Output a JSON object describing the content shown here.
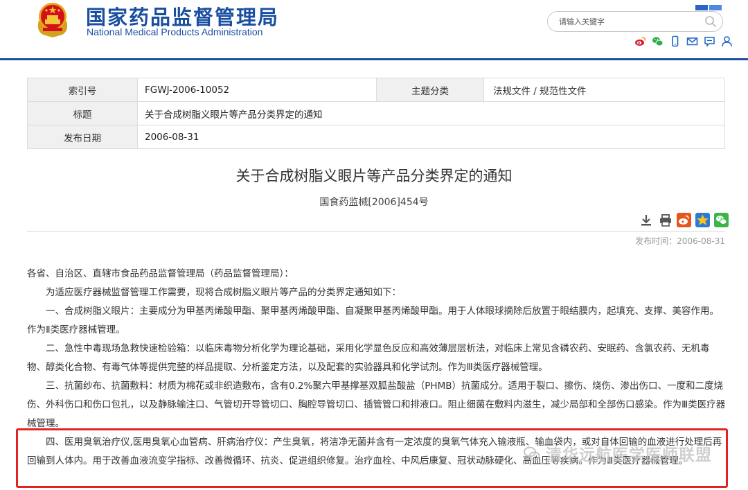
{
  "header": {
    "site_name_cn": "国家药品监督管理局",
    "site_name_en": "National Medical Products Administration",
    "search_placeholder": "请输入关键字",
    "icons": [
      "weibo-icon",
      "wechat-icon",
      "mobile-icon",
      "mail-icon",
      "message-icon",
      "user-icon"
    ]
  },
  "info": {
    "index_label": "索引号",
    "index_value": "FGWJ-2006-10052",
    "category_label": "主题分类",
    "category_value": "法规文件 / 规范性文件",
    "title_label": "标题",
    "title_value": "关于合成树脂义眼片等产品分类界定的通知",
    "date_label": "发布日期",
    "date_value": "2006-08-31"
  },
  "document": {
    "title": "关于合成树脂义眼片等产品分类界定的通知",
    "number": "国食药监械[2006]454号",
    "publish_time": "发布时间：2006-08-31",
    "paragraphs": [
      "各省、自治区、直辖市食品药品监督管理局（药品监督管理局）：",
      "为适应医疗器械监督管理工作需要，现将合成树脂义眼片等产品的分类界定通知如下：",
      "一、合成树脂义眼片：主要成分为甲基丙烯酸甲酯、聚甲基丙烯酸甲酯、自凝聚甲基丙烯酸甲酯。用于人体眼球摘除后放置于眼结膜内，起填充、支撑、美容作用。作为Ⅱ类医疗器械管理。",
      "二、急性中毒现场急救快速检验箱：以临床毒物分析化学为理论基础，采用化学显色反应和高效薄层层析法，对临床上常见含磷农药、安眠药、含氯农药、无机毒物、醇类化合物、有毒气体等提供完整的样品提取、分析鉴定方法，以及配套的实验器具和化学试剂。作为Ⅲ类医疗器械管理。",
      "三、抗菌纱布、抗菌敷料：材质为棉花或非织造敷布，含有0.2%聚六甲基撑基双胍盐酸盐（PHMB）抗菌成分。适用于裂口、擦伤、烧伤、渗出伤口、一度和二度烧伤、外科伤口和伤口包扎，以及静脉输注口、气管切开导管切口、胸腔导管切口、插管管口和排液口。阻止细菌在敷料内滋生，减少局部和全部伤口感染。作为Ⅲ类医疗器械管理。",
      "四、医用臭氧治疗仪,医用臭氧心血管病、肝病治疗仪：产生臭氧，将洁净无菌并含有一定浓度的臭氧气体充入输液瓶、输血袋内，或对自体回输的血液进行处理后再回输到人体内。用于改善血液流变学指标、改善微循环、抗炎、促进组织修复。治疗血栓、中风后康复、冠状动脉硬化、高血压等疾病。作为Ⅲ类医疗器械管理。"
    ]
  },
  "watermark": {
    "text": "清华远航医学医师联盟"
  },
  "colors": {
    "brand_blue": "#1a4fa0",
    "highlight_red": "#e52222",
    "label_bg": "#f0f0f0"
  }
}
